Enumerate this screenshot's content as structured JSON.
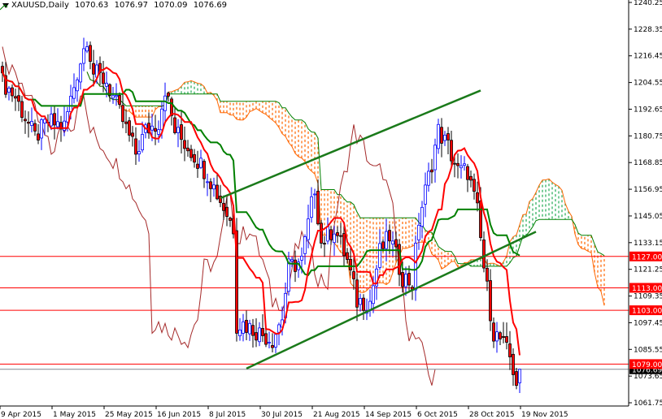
{
  "header": {
    "symbol": "XAUUSD,Daily",
    "open": "1070.63",
    "high": "1076.97",
    "low": "1070.09",
    "close": "1076.69"
  },
  "colors": {
    "bull": "#0000ff",
    "bear": "#ff0000",
    "tenkan": "#ff0000",
    "kijun": "#008000",
    "chikou": "#a52a2a",
    "cloud_bear": "#ff6600",
    "cloud_bull": "#22aa55",
    "level": "#ff0000",
    "trend": "#1a7a1a",
    "current": "#808890"
  },
  "chart_data": {
    "type": "candlestick",
    "title": "XAUUSD,Daily",
    "ylim": [
      1058,
      1242
    ],
    "y_ticks": [
      "1240.25",
      "1228.35",
      "1216.45",
      "1204.55",
      "1192.65",
      "1180.75",
      "1168.85",
      "1156.95",
      "1145.05",
      "1133.15",
      "1121.25",
      "1109.35",
      "1097.45",
      "1085.55",
      "1073.65",
      "1061.75"
    ],
    "x_ticks": [
      {
        "bar": 0,
        "label": "9 Apr 2015"
      },
      {
        "bar": 16,
        "label": "1 May 2015"
      },
      {
        "bar": 32,
        "label": "25 May 2015"
      },
      {
        "bar": 48,
        "label": "16 Jun 2015"
      },
      {
        "bar": 64,
        "label": "8 Jul 2015"
      },
      {
        "bar": 80,
        "label": "30 Jul 2015"
      },
      {
        "bar": 96,
        "label": "21 Aug 2015"
      },
      {
        "bar": 112,
        "label": "14 Sep 2015"
      },
      {
        "bar": 128,
        "label": "6 Oct 2015"
      },
      {
        "bar": 144,
        "label": "28 Oct 2015"
      },
      {
        "bar": 160,
        "label": "19 Nov 2015"
      }
    ],
    "bars": 160,
    "close_path": [
      [
        0,
        1205
      ],
      [
        4,
        1198
      ],
      [
        10,
        1180
      ],
      [
        14,
        1187
      ],
      [
        19,
        1185
      ],
      [
        23,
        1209
      ],
      [
        26,
        1225
      ],
      [
        28,
        1209
      ],
      [
        32,
        1205
      ],
      [
        36,
        1191
      ],
      [
        41,
        1173
      ],
      [
        44,
        1183
      ],
      [
        48,
        1187
      ],
      [
        50,
        1202
      ],
      [
        53,
        1183
      ],
      [
        58,
        1174
      ],
      [
        63,
        1164
      ],
      [
        68,
        1149
      ],
      [
        71,
        1140
      ],
      [
        72,
        1097
      ],
      [
        74,
        1097
      ],
      [
        79,
        1093
      ],
      [
        83,
        1090
      ],
      [
        86,
        1100
      ],
      [
        88,
        1122
      ],
      [
        92,
        1125
      ],
      [
        96,
        1158
      ],
      [
        98,
        1133
      ],
      [
        102,
        1140
      ],
      [
        106,
        1125
      ],
      [
        109,
        1107
      ],
      [
        113,
        1107
      ],
      [
        116,
        1129
      ],
      [
        119,
        1136
      ],
      [
        123,
        1118
      ],
      [
        126,
        1115
      ],
      [
        128,
        1143
      ],
      [
        132,
        1169
      ],
      [
        134,
        1183
      ],
      [
        137,
        1176
      ],
      [
        140,
        1165
      ],
      [
        143,
        1165
      ],
      [
        146,
        1147
      ],
      [
        148,
        1122
      ],
      [
        151,
        1093
      ],
      [
        153,
        1090
      ],
      [
        156,
        1082
      ],
      [
        158,
        1071
      ],
      [
        159,
        1076.69
      ]
    ],
    "levels": [
      {
        "price": 1127.0,
        "label": "1127.00"
      },
      {
        "price": 1113.0,
        "label": "1113.00"
      },
      {
        "price": 1103.0,
        "label": "1103.00"
      },
      {
        "price": 1079.0,
        "label": "1079.00"
      }
    ],
    "current_price": {
      "price": 1076.69,
      "label": "1076.69"
    },
    "trendlines": [
      {
        "from": [
          67,
          1153
        ],
        "to": [
          147,
          1201
        ]
      },
      {
        "from": [
          75,
          1077
        ],
        "to": [
          164,
          1138
        ]
      }
    ],
    "indicators": [
      "Ichimoku Kinko Hyo (9,26,52)"
    ]
  }
}
